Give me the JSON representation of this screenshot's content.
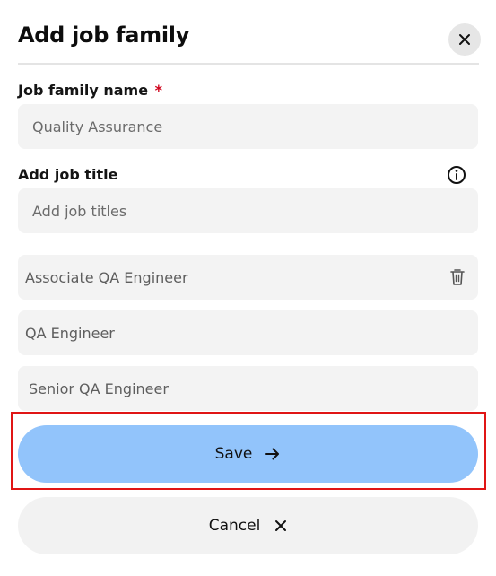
{
  "dialog": {
    "title": "Add job family",
    "close_icon": "close-icon"
  },
  "job_family_name": {
    "label": "Job family name",
    "required_mark": "*",
    "value": "Quality Assurance"
  },
  "add_job_title": {
    "label": "Add job title",
    "info_icon": "info-icon",
    "placeholder": "Add job titles"
  },
  "job_titles": [
    {
      "label": "Associate QA Engineer",
      "icon": "trash-icon"
    },
    {
      "label": "QA Engineer"
    },
    {
      "label": "Senior QA Engineer"
    }
  ],
  "actions": {
    "save_label": "Save",
    "save_icon": "arrow-right-icon",
    "cancel_label": "Cancel",
    "cancel_icon": "close-icon"
  },
  "colors": {
    "save_button": "#92c4fb",
    "highlight_border": "#e01515",
    "required_mark": "#d0021b"
  }
}
